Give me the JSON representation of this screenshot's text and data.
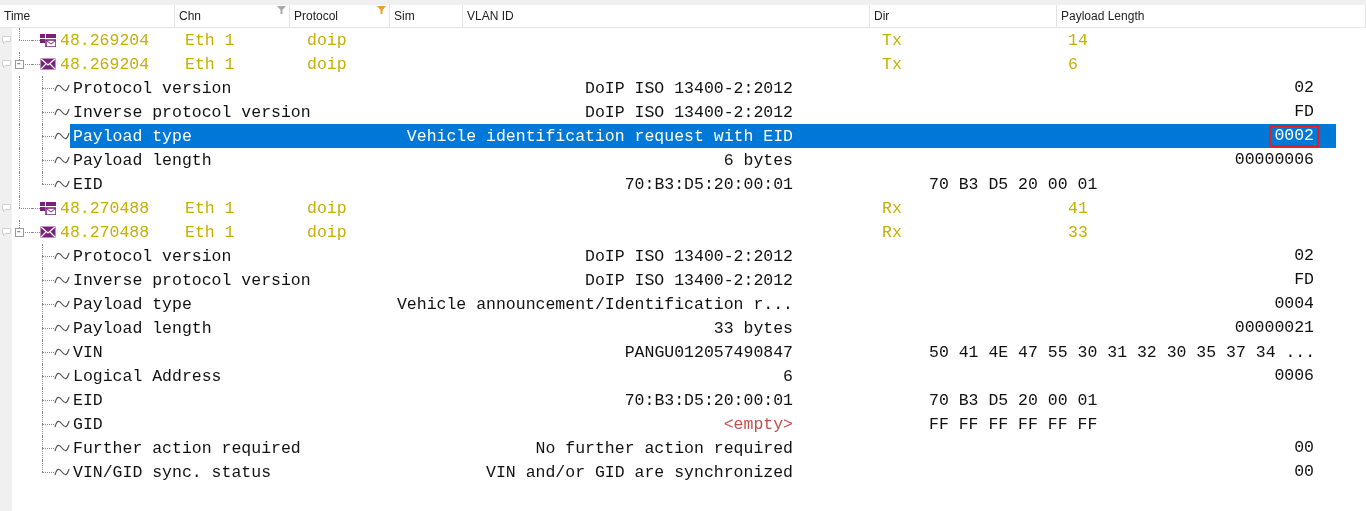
{
  "columns": [
    {
      "label": "Time"
    },
    {
      "label": "Chn",
      "filter_active": false
    },
    {
      "label": "Protocol",
      "filter_active": true
    },
    {
      "label": "Sim"
    },
    {
      "label": "VLAN ID"
    },
    {
      "label": "Dir"
    },
    {
      "label": "Payload Length"
    }
  ],
  "messages": [
    {
      "kind": "frame",
      "time": "48.269204",
      "chn": "Eth 1",
      "protocol": "doip",
      "dir": "Tx",
      "length": "14"
    },
    {
      "kind": "message",
      "expanded": true,
      "time": "48.269204",
      "chn": "Eth 1",
      "protocol": "doip",
      "dir": "Tx",
      "length": "6",
      "fields": [
        {
          "name": "Protocol version",
          "kind": "value",
          "value": "DoIP ISO 13400-2:2012",
          "hex": "02",
          "selected": false
        },
        {
          "name": "Inverse protocol version",
          "kind": "value",
          "value": "DoIP ISO 13400-2:2012",
          "hex": "FD",
          "selected": false
        },
        {
          "name": "Payload type",
          "kind": "value",
          "value": "Vehicle identification request with EID",
          "hex": "0002",
          "selected": true
        },
        {
          "name": "Payload length",
          "kind": "value",
          "value": "6 bytes",
          "hex": "00000006",
          "selected": false
        },
        {
          "name": "EID",
          "kind": "value",
          "value": "70:B3:D5:20:00:01",
          "bytes": "70 B3 D5 20 00 01",
          "selected": false
        }
      ]
    },
    {
      "kind": "frame",
      "time": "48.270488",
      "chn": "Eth 1",
      "protocol": "doip",
      "dir": "Rx",
      "length": "41"
    },
    {
      "kind": "message",
      "expanded": true,
      "time": "48.270488",
      "chn": "Eth 1",
      "protocol": "doip",
      "dir": "Rx",
      "length": "33",
      "fields": [
        {
          "name": "Protocol version",
          "kind": "value",
          "value": "DoIP ISO 13400-2:2012",
          "hex": "02",
          "selected": false
        },
        {
          "name": "Inverse protocol version",
          "kind": "value",
          "value": "DoIP ISO 13400-2:2012",
          "hex": "FD",
          "selected": false
        },
        {
          "name": "Payload type",
          "kind": "value",
          "value": "Vehicle announcement/Identification r...",
          "hex": "0004",
          "selected": false
        },
        {
          "name": "Payload length",
          "kind": "value",
          "value": "33 bytes",
          "hex": "00000021",
          "selected": false
        },
        {
          "name": "VIN",
          "kind": "value",
          "value": "PANGU012057490847",
          "bytes": "50 41 4E 47 55 30 31 32 30 35 37 34 ...",
          "selected": false
        },
        {
          "name": "Logical Address",
          "kind": "value",
          "value": "6",
          "hex": "0006",
          "selected": false
        },
        {
          "name": "EID",
          "kind": "value",
          "value": "70:B3:D5:20:00:01",
          "bytes": "70 B3 D5 20 00 01",
          "selected": false
        },
        {
          "name": "GID",
          "kind": "empty",
          "value": "<empty>",
          "bytes": "FF FF FF FF FF FF",
          "selected": false
        },
        {
          "name": "Further action required",
          "kind": "value",
          "value": "No further action required",
          "hex": "00",
          "selected": false
        },
        {
          "name": "VIN/GID sync. status",
          "kind": "value",
          "value": "VIN and/or GID are synchronized",
          "hex": "00",
          "selected": false
        }
      ]
    }
  ]
}
